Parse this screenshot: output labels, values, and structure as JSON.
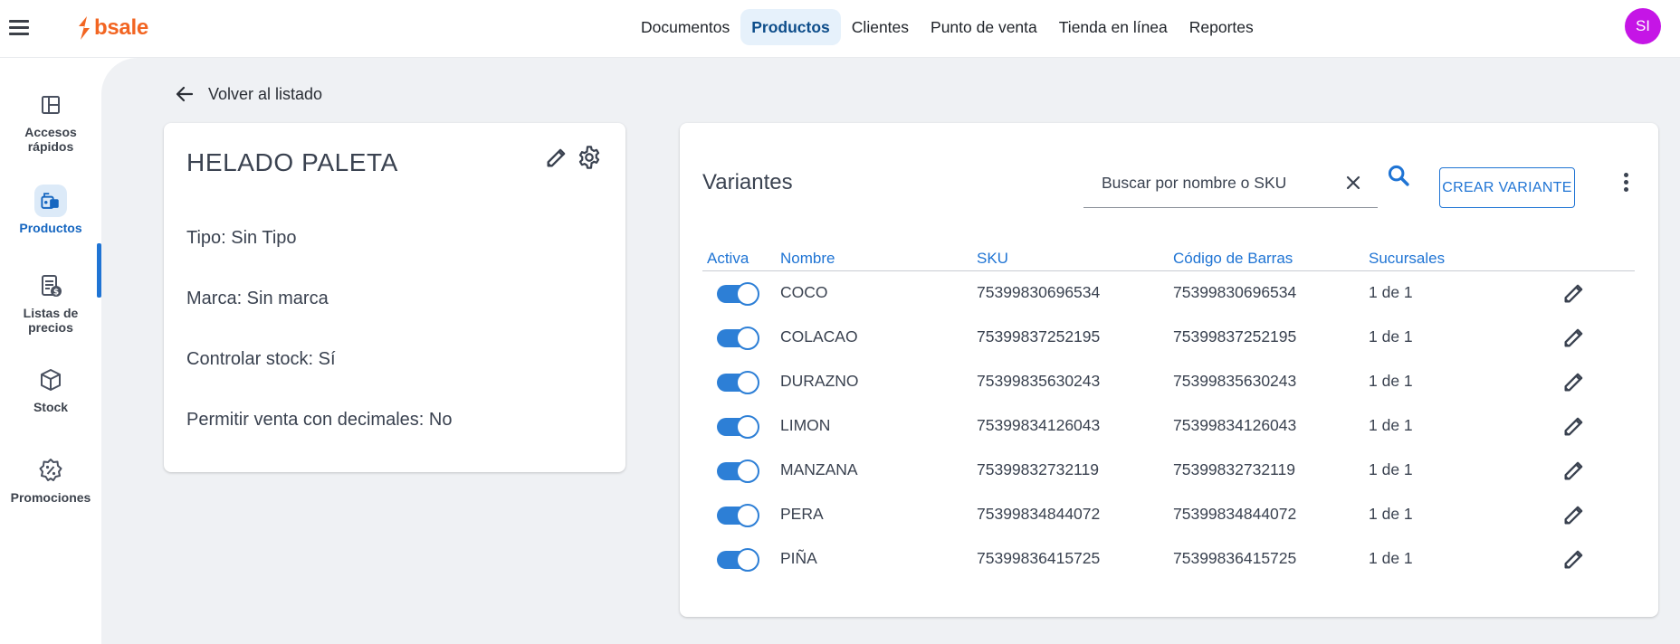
{
  "header": {
    "logo": "bsale",
    "nav": [
      {
        "label": "Documentos"
      },
      {
        "label": "Productos"
      },
      {
        "label": "Clientes"
      },
      {
        "label": "Punto de venta"
      },
      {
        "label": "Tienda en línea"
      },
      {
        "label": "Reportes"
      }
    ],
    "active_nav": "Productos",
    "avatar_initials": "SI",
    "colors": {
      "brand": "#f26522",
      "accent": "#1f74d4",
      "avatar": "#c515e6"
    }
  },
  "sidebar": {
    "items": [
      {
        "label_line1": "Accesos",
        "label_line2": "rápidos",
        "icon": "dashboard-icon"
      },
      {
        "label_line1": "Productos",
        "label_line2": "",
        "icon": "products-icon"
      },
      {
        "label_line1": "Listas de",
        "label_line2": "precios",
        "icon": "price-list-icon"
      },
      {
        "label_line1": "Stock",
        "label_line2": "",
        "icon": "box-icon"
      },
      {
        "label_line1": "Promociones",
        "label_line2": "",
        "icon": "promotion-icon"
      }
    ],
    "active_item": "Productos"
  },
  "main": {
    "back_label": "Volver al listado",
    "product": {
      "name": "HELADO PALETA",
      "tipo": "Tipo: Sin Tipo",
      "marca": "Marca: Sin marca",
      "controlar_stock": "Controlar stock: Sí",
      "permitir_decimales": "Permitir venta con decimales: No"
    },
    "variants": {
      "title": "Variantes",
      "search_placeholder": "Buscar por nombre o SKU",
      "create_label": "CREAR VARIANTE",
      "columns": [
        "Activa",
        "Nombre",
        "SKU",
        "Código de Barras",
        "Sucursales"
      ],
      "rows": [
        {
          "active": true,
          "nombre": "COCO",
          "sku": "75399830696534",
          "barcode": "75399830696534",
          "sucursales": "1 de 1"
        },
        {
          "active": true,
          "nombre": "COLACAO",
          "sku": "75399837252195",
          "barcode": "75399837252195",
          "sucursales": "1 de 1"
        },
        {
          "active": true,
          "nombre": "DURAZNO",
          "sku": "75399835630243",
          "barcode": "75399835630243",
          "sucursales": "1 de 1"
        },
        {
          "active": true,
          "nombre": "LIMON",
          "sku": "75399834126043",
          "barcode": "75399834126043",
          "sucursales": "1 de 1"
        },
        {
          "active": true,
          "nombre": "MANZANA",
          "sku": "75399832732119",
          "barcode": "75399832732119",
          "sucursales": "1 de 1"
        },
        {
          "active": true,
          "nombre": "PERA",
          "sku": "75399834844072",
          "barcode": "75399834844072",
          "sucursales": "1 de 1"
        },
        {
          "active": true,
          "nombre": "PIÑA",
          "sku": "75399836415725",
          "barcode": "75399836415725",
          "sucursales": "1 de 1"
        }
      ]
    }
  }
}
